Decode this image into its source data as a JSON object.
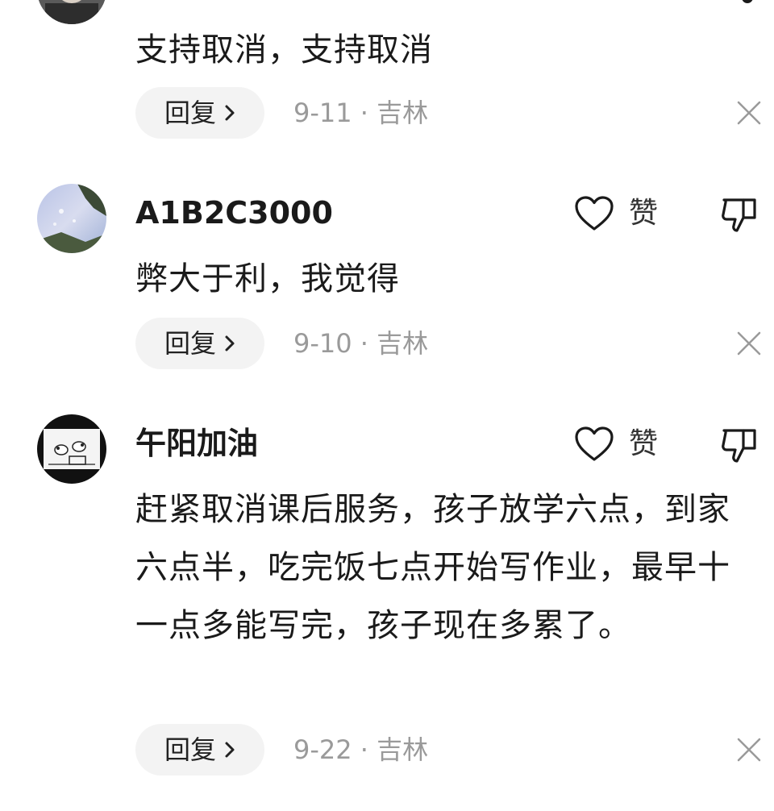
{
  "comments": [
    {
      "username": "",
      "content": "支持取消，支持取消",
      "reply_label": "回复",
      "date": "9-11",
      "separator": "·",
      "location": "吉林"
    },
    {
      "username": "A1B2C3000",
      "like_label": "赞",
      "content": "弊大于利，我觉得",
      "reply_label": "回复",
      "date": "9-10",
      "separator": "·",
      "location": "吉林"
    },
    {
      "username": "午阳加油",
      "like_label": "赞",
      "content": "赶紧取消课后服务，孩子放学六点，到家六点半，吃完饭七点开始写作业，最早十一点多能写完，孩子现在多累了。",
      "reply_label": "回复",
      "date": "9-22",
      "separator": "·",
      "location": "吉林"
    }
  ],
  "icons": {
    "like": "heart-icon",
    "dislike": "thumbs-down-icon",
    "close": "close-icon",
    "chevron": "chevron-right-icon"
  },
  "colors": {
    "text": "#1a1a1a",
    "meta": "#9a9a9a",
    "reply_bg": "#f3f3f3"
  }
}
